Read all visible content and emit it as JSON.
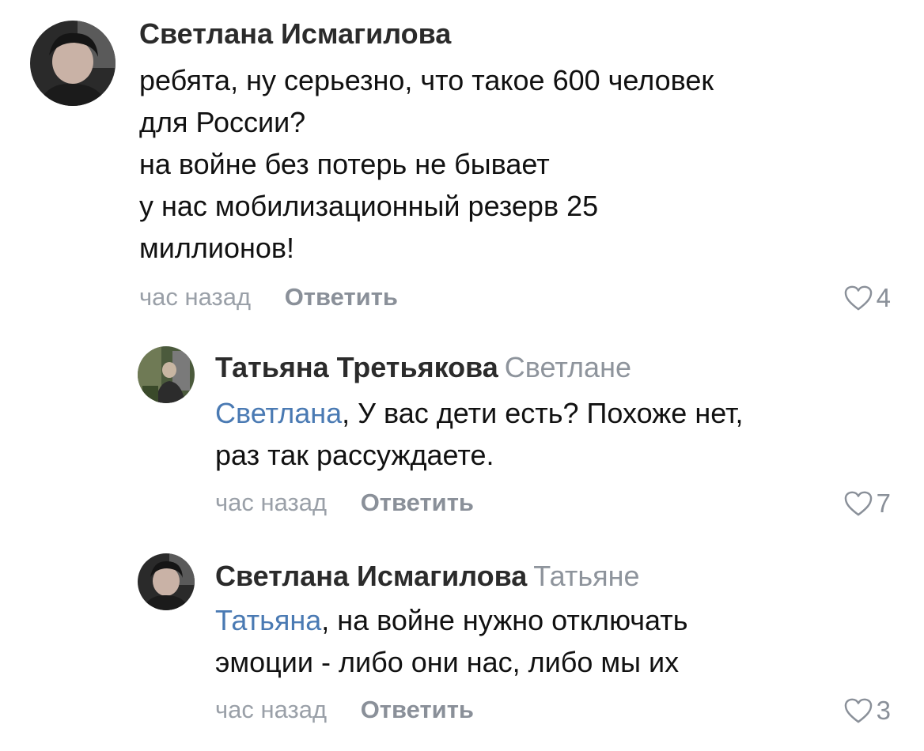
{
  "comments": [
    {
      "author": "Светлана Исмагилова",
      "reply_to": "",
      "mention": "",
      "lines": [
        "ребята, ну серьезно, что такое 600 человек",
        "для России?",
        "на войне без потерь не бывает",
        "у нас мобилизационный резерв 25",
        "миллионов!"
      ],
      "time": "час назад",
      "reply_label": "Ответить",
      "likes": "4"
    },
    {
      "author": "Татьяна Третьякова",
      "reply_to": "Светлане",
      "mention": "Светлана",
      "lines": [
        ", У вас дети есть? Похоже нет,",
        "раз так рассуждаете."
      ],
      "time": "час назад",
      "reply_label": "Ответить",
      "likes": "7"
    },
    {
      "author": "Светлана Исмагилова",
      "reply_to": "Татьяне",
      "mention": "Татьяна",
      "lines": [
        ", на войне нужно отключать",
        "эмоции - либо они нас, либо мы их"
      ],
      "time": "час назад",
      "reply_label": "Ответить",
      "likes": "3"
    }
  ],
  "colors": {
    "mention": "#4a7ab3",
    "secondary": "#8e949c"
  }
}
